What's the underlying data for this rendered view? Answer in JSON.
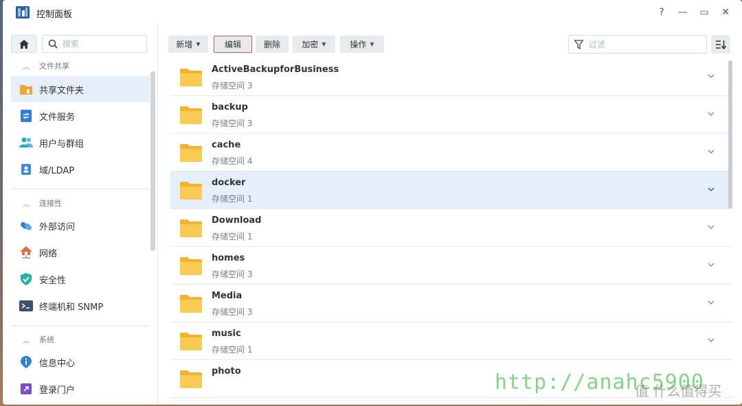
{
  "window": {
    "title": "控制面板",
    "controls": {
      "help": "?",
      "minimize": "—",
      "maximize": "▭",
      "close": "✕"
    }
  },
  "sidebar": {
    "search_placeholder": "搜索",
    "sections": [
      {
        "label": "文件共享"
      },
      {
        "label": "连接性"
      },
      {
        "label": "系统"
      }
    ],
    "items": [
      {
        "label": "共享文件夹",
        "icon": "shared-folder-icon"
      },
      {
        "label": "文件服务",
        "icon": "file-services-icon"
      },
      {
        "label": "用户与群组",
        "icon": "users-icon"
      },
      {
        "label": "域/LDAP",
        "icon": "domain-icon"
      },
      {
        "label": "外部访问",
        "icon": "external-access-icon"
      },
      {
        "label": "网络",
        "icon": "network-icon"
      },
      {
        "label": "安全性",
        "icon": "security-icon"
      },
      {
        "label": "终端机和 SNMP",
        "icon": "terminal-icon"
      },
      {
        "label": "信息中心",
        "icon": "info-icon"
      },
      {
        "label": "登录门户",
        "icon": "login-portal-icon"
      }
    ]
  },
  "toolbar": {
    "create": "新增",
    "edit": "编辑",
    "delete": "删除",
    "encrypt": "加密",
    "action": "操作",
    "filter_placeholder": "过滤"
  },
  "folders": [
    {
      "name": "ActiveBackupforBusiness",
      "volume": "存储空间 3"
    },
    {
      "name": "backup",
      "volume": "存储空间 3"
    },
    {
      "name": "cache",
      "volume": "存储空间 4"
    },
    {
      "name": "docker",
      "volume": "存储空间 1"
    },
    {
      "name": "Download",
      "volume": "存储空间 1"
    },
    {
      "name": "homes",
      "volume": "存储空间 3"
    },
    {
      "name": "Media",
      "volume": "存储空间 3"
    },
    {
      "name": "music",
      "volume": "存储空间 1"
    },
    {
      "name": "photo",
      "volume": ""
    }
  ],
  "watermark": {
    "url": "http://anahc5900",
    "site": "值 什么值得买"
  },
  "colors": {
    "accent": "#1a73c8",
    "folder": "#f7c548",
    "selected_row": "#e5effa",
    "active_side": "#e6eef8"
  }
}
